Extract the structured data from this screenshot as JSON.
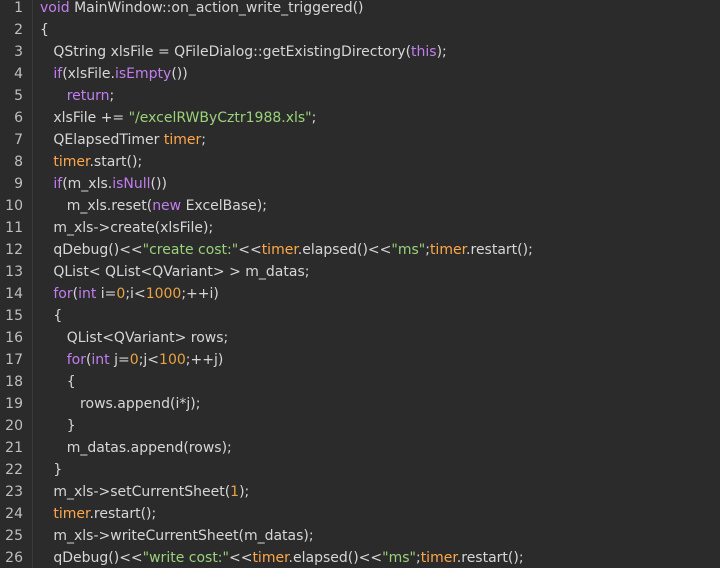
{
  "editor": {
    "colors": {
      "background": "#2b2b2b",
      "text": "#d6d6d6",
      "keyword": "#c27ef0",
      "member": "#ffa84a",
      "number": "#e8a342",
      "string": "#9ad27a",
      "line_number": "#bfbfbf"
    },
    "lines": [
      {
        "n": "1",
        "tokens": [
          {
            "t": "void",
            "k": "kw"
          },
          {
            "t": " MainWindow::on_action_write_triggered()",
            "k": ""
          }
        ]
      },
      {
        "n": "2",
        "tokens": [
          {
            "t": "{",
            "k": ""
          }
        ]
      },
      {
        "n": "3",
        "tokens": [
          {
            "t": "   QString xlsFile = QFileDialog::getExistingDirectory(",
            "k": ""
          },
          {
            "t": "this",
            "k": "kw"
          },
          {
            "t": ");",
            "k": ""
          }
        ]
      },
      {
        "n": "4",
        "tokens": [
          {
            "t": "   ",
            "k": ""
          },
          {
            "t": "if",
            "k": "kw"
          },
          {
            "t": "(xlsFile.",
            "k": ""
          },
          {
            "t": "isEmpty",
            "k": "kw"
          },
          {
            "t": "())",
            "k": ""
          }
        ]
      },
      {
        "n": "5",
        "tokens": [
          {
            "t": "      ",
            "k": ""
          },
          {
            "t": "return",
            "k": "kw"
          },
          {
            "t": ";",
            "k": ""
          }
        ]
      },
      {
        "n": "6",
        "tokens": [
          {
            "t": "   xlsFile += ",
            "k": ""
          },
          {
            "t": "\"/excelRWByCztr1988.xls\"",
            "k": "str"
          },
          {
            "t": ";",
            "k": ""
          }
        ]
      },
      {
        "n": "7",
        "tokens": [
          {
            "t": "   QElapsedTimer ",
            "k": ""
          },
          {
            "t": "timer",
            "k": "fn"
          },
          {
            "t": ";",
            "k": ""
          }
        ]
      },
      {
        "n": "8",
        "tokens": [
          {
            "t": "   ",
            "k": ""
          },
          {
            "t": "timer",
            "k": "fn"
          },
          {
            "t": ".start();",
            "k": ""
          }
        ]
      },
      {
        "n": "9",
        "tokens": [
          {
            "t": "   ",
            "k": ""
          },
          {
            "t": "if",
            "k": "kw"
          },
          {
            "t": "(m_xls.",
            "k": ""
          },
          {
            "t": "isNull",
            "k": "kw"
          },
          {
            "t": "())",
            "k": ""
          }
        ]
      },
      {
        "n": "10",
        "tokens": [
          {
            "t": "      m_xls.reset(",
            "k": ""
          },
          {
            "t": "new",
            "k": "kw"
          },
          {
            "t": " ExcelBase);",
            "k": ""
          }
        ]
      },
      {
        "n": "11",
        "tokens": [
          {
            "t": "   m_xls->create(xlsFile);",
            "k": ""
          }
        ]
      },
      {
        "n": "12",
        "tokens": [
          {
            "t": "   qDebug()<<",
            "k": ""
          },
          {
            "t": "\"create cost:\"",
            "k": "str"
          },
          {
            "t": "<<",
            "k": ""
          },
          {
            "t": "timer",
            "k": "fn"
          },
          {
            "t": ".elapsed()<<",
            "k": ""
          },
          {
            "t": "\"ms\"",
            "k": "str"
          },
          {
            "t": ";",
            "k": ""
          },
          {
            "t": "timer",
            "k": "fn"
          },
          {
            "t": ".restart();",
            "k": ""
          }
        ]
      },
      {
        "n": "13",
        "tokens": [
          {
            "t": "   QList< QList<QVariant> > m_datas;",
            "k": ""
          }
        ]
      },
      {
        "n": "14",
        "tokens": [
          {
            "t": "   ",
            "k": ""
          },
          {
            "t": "for",
            "k": "kw"
          },
          {
            "t": "(",
            "k": ""
          },
          {
            "t": "int",
            "k": "kw"
          },
          {
            "t": " i=",
            "k": ""
          },
          {
            "t": "0",
            "k": "num"
          },
          {
            "t": ";i<",
            "k": ""
          },
          {
            "t": "1000",
            "k": "num"
          },
          {
            "t": ";++i)",
            "k": ""
          }
        ]
      },
      {
        "n": "15",
        "tokens": [
          {
            "t": "   {",
            "k": ""
          }
        ]
      },
      {
        "n": "16",
        "tokens": [
          {
            "t": "      QList<QVariant> rows;",
            "k": ""
          }
        ]
      },
      {
        "n": "17",
        "tokens": [
          {
            "t": "      ",
            "k": ""
          },
          {
            "t": "for",
            "k": "kw"
          },
          {
            "t": "(",
            "k": ""
          },
          {
            "t": "int",
            "k": "kw"
          },
          {
            "t": " j=",
            "k": ""
          },
          {
            "t": "0",
            "k": "num"
          },
          {
            "t": ";j<",
            "k": ""
          },
          {
            "t": "100",
            "k": "num"
          },
          {
            "t": ";++j)",
            "k": ""
          }
        ]
      },
      {
        "n": "18",
        "tokens": [
          {
            "t": "      {",
            "k": ""
          }
        ]
      },
      {
        "n": "19",
        "tokens": [
          {
            "t": "         rows.append(i*j);",
            "k": ""
          }
        ]
      },
      {
        "n": "20",
        "tokens": [
          {
            "t": "      }",
            "k": ""
          }
        ]
      },
      {
        "n": "21",
        "tokens": [
          {
            "t": "      m_datas.append(rows);",
            "k": ""
          }
        ]
      },
      {
        "n": "22",
        "tokens": [
          {
            "t": "   }",
            "k": ""
          }
        ]
      },
      {
        "n": "23",
        "tokens": [
          {
            "t": "   m_xls->setCurrentSheet(",
            "k": ""
          },
          {
            "t": "1",
            "k": "num"
          },
          {
            "t": ");",
            "k": ""
          }
        ]
      },
      {
        "n": "24",
        "tokens": [
          {
            "t": "   ",
            "k": ""
          },
          {
            "t": "timer",
            "k": "fn"
          },
          {
            "t": ".restart();",
            "k": ""
          }
        ]
      },
      {
        "n": "25",
        "tokens": [
          {
            "t": "   m_xls->writeCurrentSheet(m_datas);",
            "k": ""
          }
        ]
      },
      {
        "n": "26",
        "tokens": [
          {
            "t": "   qDebug()<<",
            "k": ""
          },
          {
            "t": "\"write cost:\"",
            "k": "str"
          },
          {
            "t": "<<",
            "k": ""
          },
          {
            "t": "timer",
            "k": "fn"
          },
          {
            "t": ".elapsed()<<",
            "k": ""
          },
          {
            "t": "\"ms\"",
            "k": "str"
          },
          {
            "t": ";",
            "k": ""
          },
          {
            "t": "timer",
            "k": "fn"
          },
          {
            "t": ".restart();",
            "k": ""
          }
        ]
      }
    ]
  }
}
